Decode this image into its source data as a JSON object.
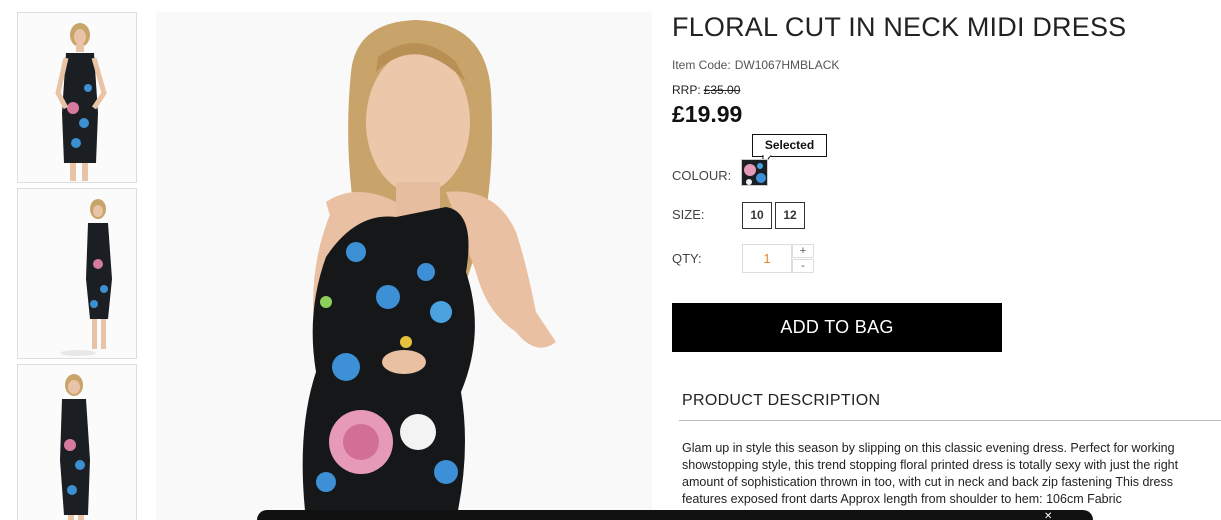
{
  "thumbnails": [
    {
      "alt": "Dress front view"
    },
    {
      "alt": "Dress full length view"
    },
    {
      "alt": "Dress side view"
    }
  ],
  "product": {
    "title": "FLORAL CUT IN NECK MIDI DRESS",
    "item_code_label": "Item Code:",
    "item_code": "DW1067HMBLACK",
    "rrp_label": "RRP:",
    "rrp_value": "£35.00",
    "price": "£19.99"
  },
  "colour": {
    "label": "COLOUR:",
    "tooltip": "Selected"
  },
  "size": {
    "label": "SIZE:",
    "options": [
      "10",
      "12"
    ]
  },
  "qty": {
    "label": "QTY:",
    "value": "1",
    "plus": "+",
    "minus": "-"
  },
  "add_to_bag": "ADD TO BAG",
  "description": {
    "heading": "PRODUCT DESCRIPTION",
    "text": "Glam up in style this season by slipping on this classic evening dress. Perfect for working showstopping style, this trend stopping floral printed dress is totally sexy with just the right amount of sophistication thrown in too, with cut in neck and back zip fastening This dress features exposed front darts   Approx length from shoulder to hem: 106cm   Fabric"
  },
  "colors": {
    "button_bg": "#000000",
    "qty_text": "#e08a1e"
  }
}
